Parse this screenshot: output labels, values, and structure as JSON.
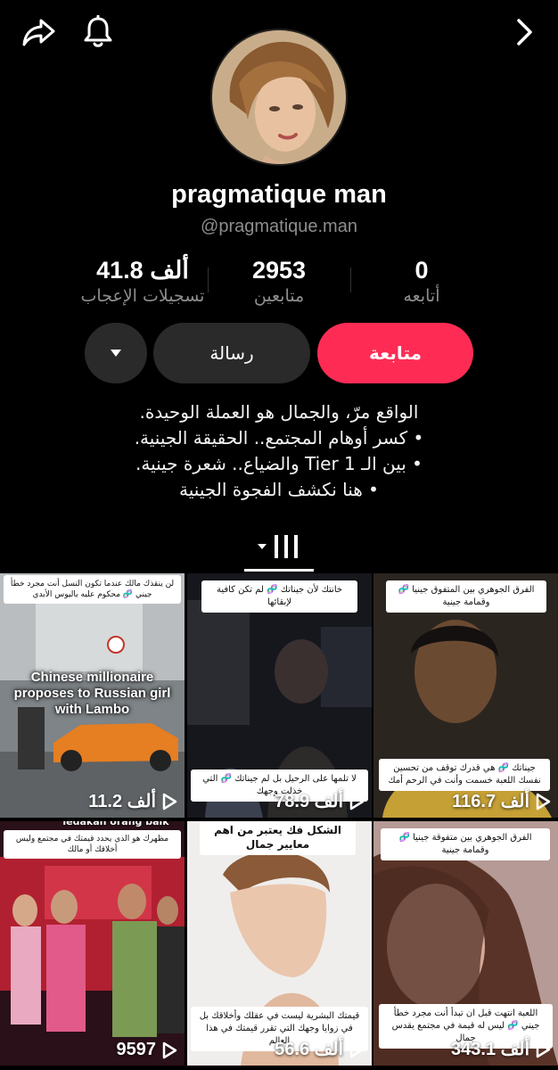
{
  "header": {
    "share_icon": "share-arrow-icon",
    "bell_icon": "bell-icon",
    "next_icon": "chevron-right-icon"
  },
  "profile": {
    "display_name": "pragmatique man",
    "handle": "@pragmatique.man"
  },
  "stats": {
    "likes": {
      "value": "41.8 ألف",
      "label": "تسجيلات الإعجاب"
    },
    "followers": {
      "value": "2953",
      "label": "متابعين"
    },
    "following": {
      "value": "0",
      "label": "أتابعه"
    }
  },
  "actions": {
    "follow_label": "متابعة",
    "message_label": "رسالة",
    "more_icon": "caret-down-icon"
  },
  "bio": {
    "line1": "الواقع مرّ، والجمال هو العملة الوحيدة.",
    "line2": "• كسر أوهام المجتمع.. الحقيقة الجينية.",
    "line3": "• بين الـ Tier 1 والضياع.. شعرة جينية.",
    "line4": "• هنا نكشف الفجوة الجينية"
  },
  "tabs": {
    "videos_icon": "videos-grid-icon"
  },
  "colors": {
    "accent": "#fe2c55",
    "background": "#000000",
    "secondary_button": "#2a2a2a",
    "muted_text": "#8d8d8d"
  },
  "videos": [
    {
      "caption_top": "الفرق الجوهري بين المتفوق جينيا 🧬 وقمامة جينية",
      "caption_bottom": "جيناتك 🧬 هي قدرك توقف من تحسين نفسك اللعبة خسمت وأنت في الرحم أمك",
      "views": "116.7 ألف"
    },
    {
      "caption_top": "خانتك لأن جيناتك 🧬 لم تكن كافية لإبقائها",
      "caption_bottom": "لا تلمها على الرحيل بل لم جيناتك 🧬 التي خذلت وجهك",
      "views": "78.9 ألف"
    },
    {
      "caption_top": "لن ينقذك مالك عندما تكون النسل أنت مجرد خطأ جيني 🧬 محكوم عليه باليوس الأبدي",
      "overlay": "Chinese millionaire proposes to Russian girl with Lambo",
      "views": "11.2 ألف"
    },
    {
      "caption_top": "الفرق الجوهري بين متفوقة جينيا 🧬 وقمامة جينية",
      "caption_bottom": "اللعبة انتهت قبل ان تبدأ أنت مجرد خطأ جيني 🧬 ليس له قيمة في مجتمع يقدس جمال",
      "views": "343.1 ألف"
    },
    {
      "caption_top": "الشكل فك يعتبر من اهم معايير جمال",
      "caption_bottom": "قيمتك البشرية ليست في عقلك وأخلاقك بل في زوايا وجهك التي تقرر قيمتك في هذا العالم",
      "views": "56.6 ألف"
    },
    {
      "caption_top": "مظهرك هو الذي يحدد قيمتك في مجتمع وليس أخلاقك أو مالك",
      "overlay_small": "ledakan orang baik yg",
      "views": "9597"
    }
  ]
}
